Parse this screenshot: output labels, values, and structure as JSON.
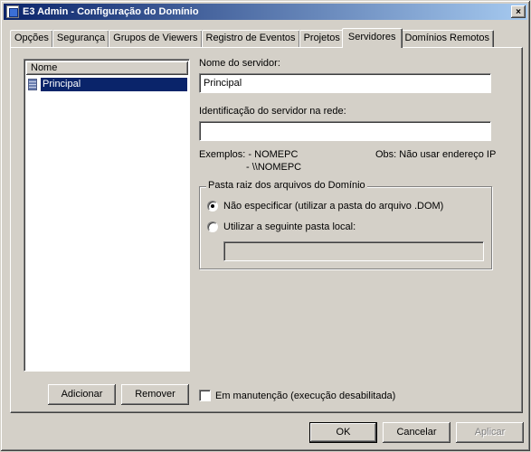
{
  "window": {
    "title": "E3 Admin - Configuração do Domínio",
    "close_glyph": "×"
  },
  "tabs": [
    {
      "label": "Opções"
    },
    {
      "label": "Segurança"
    },
    {
      "label": "Grupos de Viewers"
    },
    {
      "label": "Registro de Eventos"
    },
    {
      "label": "Projetos"
    },
    {
      "label": "Servidores",
      "active": true
    },
    {
      "label": "Domínios Remotos"
    }
  ],
  "server_list": {
    "header": "Nome",
    "items": [
      {
        "label": "Principal",
        "selected": true
      }
    ]
  },
  "buttons": {
    "add": "Adicionar",
    "remove": "Remover",
    "ok": "OK",
    "cancel": "Cancelar",
    "apply": "Aplicar"
  },
  "server_name": {
    "label": "Nome do servidor:",
    "value": "Principal"
  },
  "network_id": {
    "label": "Identificação do servidor na rede:",
    "value": ""
  },
  "examples": {
    "line1": "Exemplos: - NOMEPC",
    "line2": "- \\\\NOMEPC",
    "note": "Obs: Não usar endereço IP"
  },
  "root_folder": {
    "legend": "Pasta raiz dos arquivos do Domínio",
    "option_none": "Não especificar (utilizar a pasta do arquivo .DOM)",
    "option_local": "Utilizar a seguinte pasta local:",
    "selected": "option_none",
    "local_path": ""
  },
  "maintenance": {
    "label": "Em manutenção (execução desabilitada)",
    "checked": false
  },
  "colors": {
    "face": "#d4d0c8",
    "selection": "#0a246a",
    "title_start": "#0a246a",
    "title_end": "#a6caf0"
  }
}
